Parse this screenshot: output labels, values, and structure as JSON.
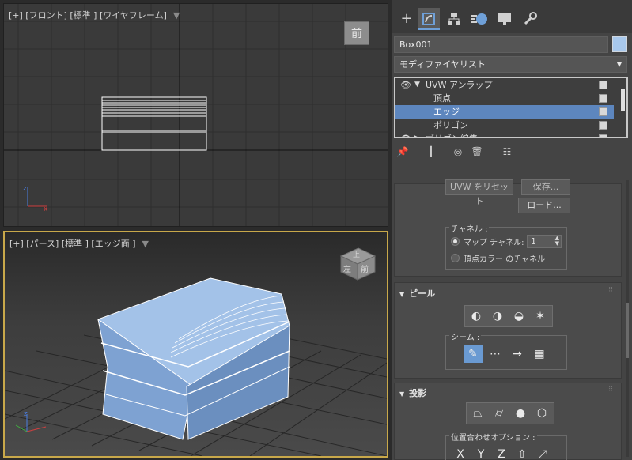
{
  "viewports": {
    "front": {
      "label": "[+] [フロント] [標準 ] [ワイヤフレーム]",
      "viewcube_label": "前"
    },
    "perspective": {
      "label": "[+] [パース] [標準 ] [エッジ面 ]",
      "viewcube_top": "上",
      "viewcube_left": "左",
      "viewcube_front": "前"
    }
  },
  "tabs": [
    "create-icon",
    "modify-icon",
    "hierarchy-icon",
    "motion-icon",
    "display-icon",
    "utilities-icon"
  ],
  "object_name": "Box001",
  "object_color": "#a8c8ec",
  "modifier_list": "モディファイヤリスト",
  "stack": {
    "modifier": "UVW アンラップ",
    "subs": [
      "頂点",
      "エッジ",
      "ポリゴン"
    ],
    "selected": "エッジ",
    "next": "ポリゴン編集"
  },
  "buttons": {
    "reset_uvw": "UVW をリセット",
    "save": "保存...",
    "load": "ロード..."
  },
  "channel": {
    "title": "チャネル :",
    "map_channel_label": "マップ チャネル:",
    "map_channel_value": "1",
    "vertex_color_label": "頂点カラー のチャネル"
  },
  "peel": {
    "title": "ピール",
    "seams_label": "シーム :"
  },
  "projection": {
    "title": "投影",
    "align_label": "位置合わせオプション :"
  },
  "colors": {
    "accent": "#5d86be",
    "active_border": "#c8a84a",
    "box_face": "#8fb2df"
  }
}
